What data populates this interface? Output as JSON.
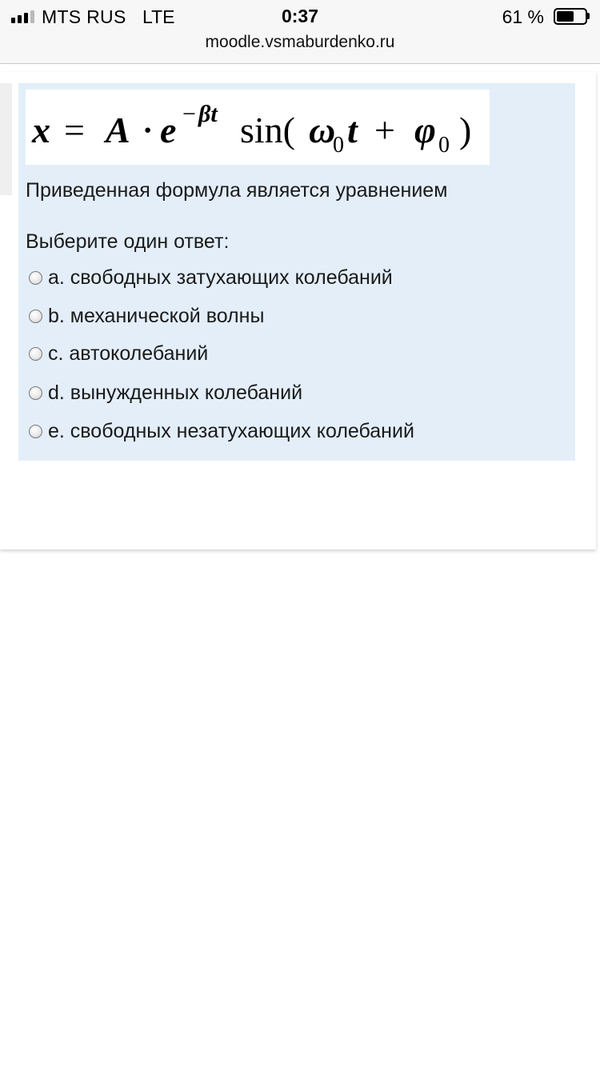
{
  "status_bar": {
    "carrier": "MTS RUS",
    "network": "LTE",
    "time": "0:37",
    "battery_percent_label": "61 %",
    "battery_level": 0.61,
    "signal_bars_filled": 3,
    "signal_bars_total": 4
  },
  "browser": {
    "url": "moodle.vsmaburdenko.ru"
  },
  "question": {
    "formula": {
      "x": "x",
      "equals": "=",
      "A": "A",
      "dot": "·",
      "e": "e",
      "exponent_minus": "−",
      "exponent_beta_t": "βt",
      "sin": "sin(",
      "omega": "ω",
      "sub_zero": "0",
      "t": "t",
      "plus": "+",
      "phi": "φ",
      "close_paren": ")"
    },
    "text": "Приведенная формула является уравнением",
    "prompt": "Выберите один ответ:",
    "answers": [
      {
        "label": "a. свободных затухающих колебаний",
        "selected": false
      },
      {
        "label": "b. механической волны",
        "selected": false
      },
      {
        "label": "c. автоколебаний",
        "selected": false
      },
      {
        "label": "d. вынужденных колебаний",
        "selected": false
      },
      {
        "label": "e. свободных незатухающих колебаний",
        "selected": false
      }
    ]
  },
  "colors": {
    "question_background": "#e3eef9",
    "chrome_background": "#f7f7f7",
    "text": "#1a1a1a"
  }
}
